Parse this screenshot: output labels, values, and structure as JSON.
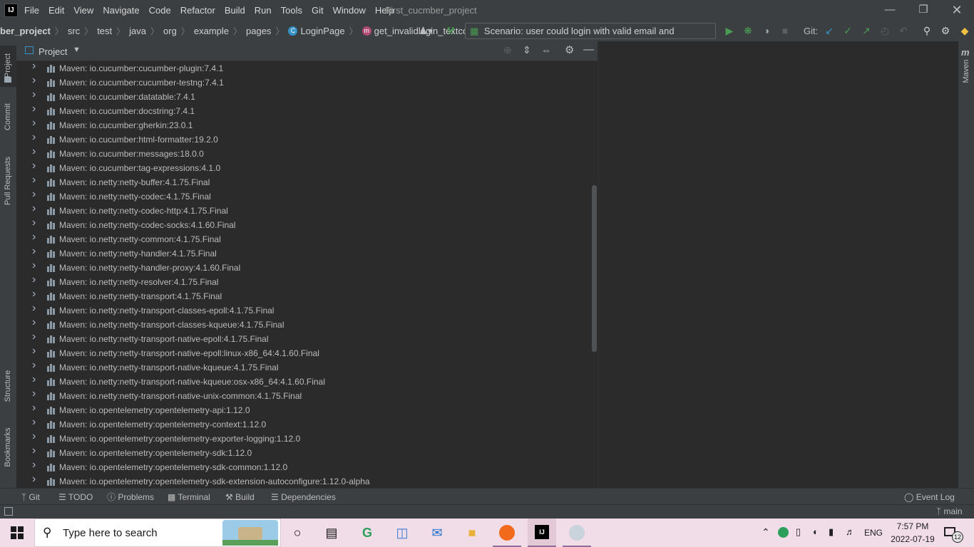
{
  "app": {
    "window_title": "First_cucmber_project",
    "menu": [
      "File",
      "Edit",
      "View",
      "Navigate",
      "Code",
      "Refactor",
      "Build",
      "Run",
      "Tools",
      "Git",
      "Window",
      "Help"
    ]
  },
  "breadcrumb": [
    "ber_project",
    "src",
    "test",
    "java",
    "org",
    "example",
    "pages",
    "LoginPage",
    "get_invalidlogin_textcolor"
  ],
  "toolbar": {
    "run_config": "Scenario: user could login with valid email and password",
    "git_label": "Git:"
  },
  "left_tabs": [
    "Project",
    "Commit",
    "Pull Requests",
    "Structure",
    "Bookmarks"
  ],
  "right_tabs": [
    "Maven"
  ],
  "project_panel": {
    "title": "Project",
    "items": [
      "Maven: io.cucumber:cucumber-plugin:7.4.1",
      "Maven: io.cucumber:cucumber-testng:7.4.1",
      "Maven: io.cucumber:datatable:7.4.1",
      "Maven: io.cucumber:docstring:7.4.1",
      "Maven: io.cucumber:gherkin:23.0.1",
      "Maven: io.cucumber:html-formatter:19.2.0",
      "Maven: io.cucumber:messages:18.0.0",
      "Maven: io.cucumber:tag-expressions:4.1.0",
      "Maven: io.netty:netty-buffer:4.1.75.Final",
      "Maven: io.netty:netty-codec:4.1.75.Final",
      "Maven: io.netty:netty-codec-http:4.1.75.Final",
      "Maven: io.netty:netty-codec-socks:4.1.60.Final",
      "Maven: io.netty:netty-common:4.1.75.Final",
      "Maven: io.netty:netty-handler:4.1.75.Final",
      "Maven: io.netty:netty-handler-proxy:4.1.60.Final",
      "Maven: io.netty:netty-resolver:4.1.75.Final",
      "Maven: io.netty:netty-transport:4.1.75.Final",
      "Maven: io.netty:netty-transport-classes-epoll:4.1.75.Final",
      "Maven: io.netty:netty-transport-classes-kqueue:4.1.75.Final",
      "Maven: io.netty:netty-transport-native-epoll:4.1.75.Final",
      "Maven: io.netty:netty-transport-native-epoll:linux-x86_64:4.1.60.Final",
      "Maven: io.netty:netty-transport-native-kqueue:4.1.75.Final",
      "Maven: io.netty:netty-transport-native-kqueue:osx-x86_64:4.1.60.Final",
      "Maven: io.netty:netty-transport-native-unix-common:4.1.75.Final",
      "Maven: io.opentelemetry:opentelemetry-api:1.12.0",
      "Maven: io.opentelemetry:opentelemetry-context:1.12.0",
      "Maven: io.opentelemetry:opentelemetry-exporter-logging:1.12.0",
      "Maven: io.opentelemetry:opentelemetry-sdk:1.12.0",
      "Maven: io.opentelemetry:opentelemetry-sdk-common:1.12.0",
      "Maven: io.opentelemetry:opentelemetry-sdk-extension-autoconfigure:1.12.0-alpha"
    ]
  },
  "bottom_tabs": {
    "git": "Git",
    "todo": "TODO",
    "problems": "Problems",
    "terminal": "Terminal",
    "build": "Build",
    "dependencies": "Dependencies",
    "event_log": "Event Log"
  },
  "status": {
    "branch": "main"
  },
  "taskbar": {
    "search_placeholder": "Type here to search",
    "language": "ENG",
    "time": "7:57 PM",
    "date": "2022-07-19",
    "notifications": "12"
  },
  "colors": {
    "accent_blue": "#3592c4",
    "run_green": "#499c54",
    "ide_bg": "#2b2b2b",
    "panel_bg": "#3c3f41"
  }
}
